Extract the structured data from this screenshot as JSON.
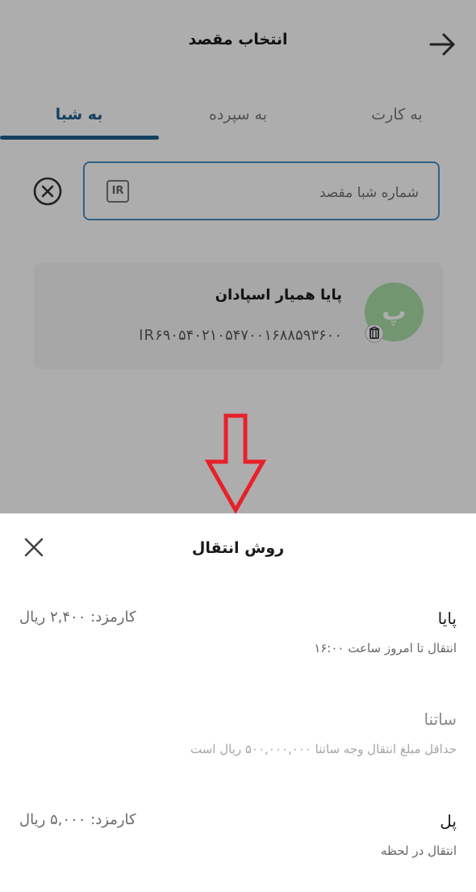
{
  "header": {
    "title": "انتخاب مقصد",
    "back_icon": "arrow-right-icon"
  },
  "tabs": [
    {
      "label": "به کارت",
      "active": false
    },
    {
      "label": "به سپرده",
      "active": false
    },
    {
      "label": "به شبا",
      "active": true
    }
  ],
  "search": {
    "placeholder": "شماره شبا مقصد",
    "value": "",
    "badge": "IR",
    "clear_icon": "circle-x-icon"
  },
  "recent": [
    {
      "initial": "پ",
      "name": "پایا همیار اسپادان",
      "iban": "IR۶۹۰۵۴۰۲۱۰۵۴۷۰۰۱۶۸۸۵۹۳۶۰۰",
      "bank_icon": "bank-logo-icon"
    }
  ],
  "sheet": {
    "title": "روش انتقال",
    "close_icon": "close-icon",
    "options": [
      {
        "name": "پایا",
        "description": "انتقال تا امروز ساعت ۱۶:۰۰",
        "fee": "کارمزد: ۲,۴۰۰ ریال",
        "enabled": true
      },
      {
        "name": "ساتنا",
        "description": "حداقل مبلغ انتقال وجه ساتنا ۵۰۰,۰۰۰,۰۰۰ ریال است",
        "fee": "",
        "enabled": false
      },
      {
        "name": "پل",
        "description": "انتقال در لحظه",
        "fee": "کارمزد: ۵,۰۰۰ ریال",
        "enabled": true
      }
    ]
  },
  "colors": {
    "accent": "#1f5f8b",
    "input_border": "#4a8ec2",
    "avatar_bg": "#a8dfa6",
    "annotation_arrow": "#e8202a"
  }
}
